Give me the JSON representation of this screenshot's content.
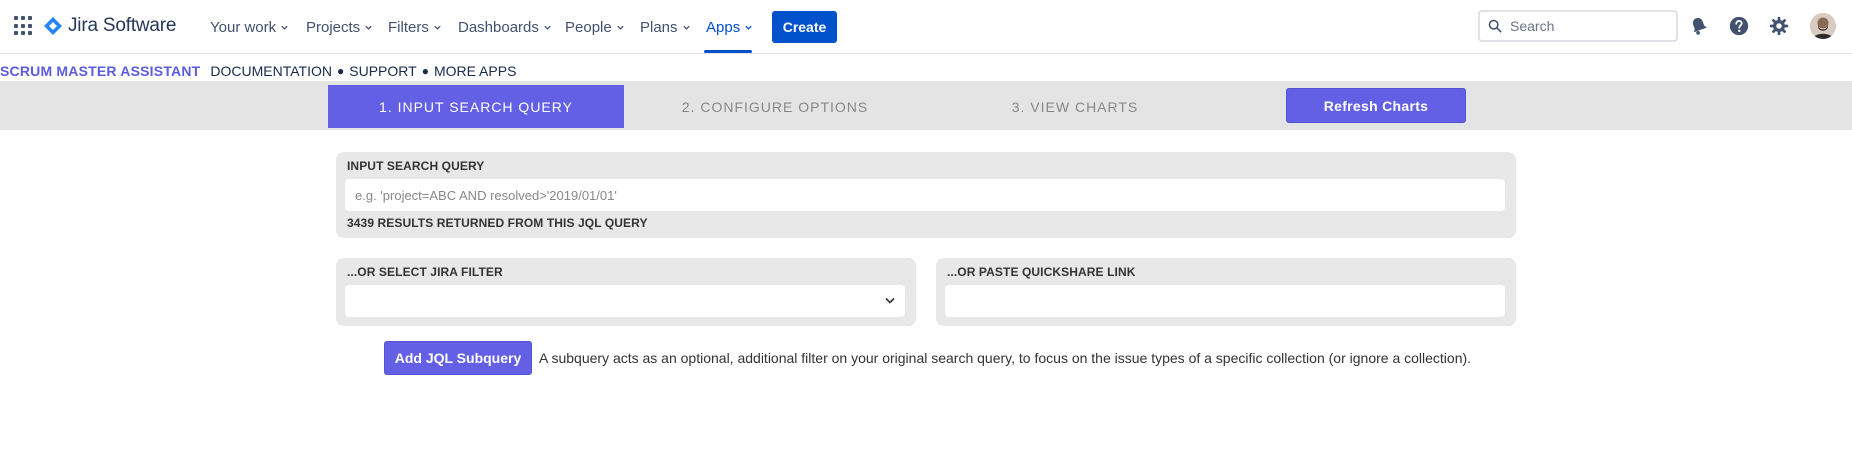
{
  "nav": {
    "brand": "Jira Software",
    "items": [
      {
        "label": "Your work",
        "active": false
      },
      {
        "label": "Projects",
        "active": false
      },
      {
        "label": "Filters",
        "active": false
      },
      {
        "label": "Dashboards",
        "active": false
      },
      {
        "label": "People",
        "active": false
      },
      {
        "label": "Plans",
        "active": false
      },
      {
        "label": "Apps",
        "active": true
      }
    ],
    "create_label": "Create",
    "search_placeholder": "Search",
    "icons": [
      "notifications-icon",
      "help-icon",
      "settings-icon"
    ],
    "accent_color": "#0052cc"
  },
  "plugin": {
    "name": "SCRUM MASTER ASSISTANT",
    "links": [
      "DOCUMENTATION",
      "SUPPORT",
      "MORE APPS"
    ],
    "separator": "●",
    "accent_color": "#6360e6"
  },
  "steps": {
    "items": [
      {
        "label": "1. INPUT SEARCH QUERY",
        "active": true
      },
      {
        "label": "2. CONFIGURE OPTIONS",
        "active": false
      },
      {
        "label": "3. VIEW CHARTS",
        "active": false
      }
    ],
    "refresh_label": "Refresh Charts"
  },
  "query": {
    "label": "INPUT SEARCH QUERY",
    "placeholder": "e.g. 'project=ABC AND resolved>'2019/01/01'",
    "value": "",
    "result_text": "3439 RESULTS RETURNED FROM THIS JQL QUERY"
  },
  "filter": {
    "label": "...OR SELECT JIRA FILTER",
    "selected": ""
  },
  "quickshare": {
    "label": "...OR PASTE QUICKSHARE LINK",
    "value": ""
  },
  "subquery": {
    "button_label": "Add JQL Subquery",
    "description": "A subquery acts as an optional, additional filter on your original search query, to focus on the issue types of a specific collection (or ignore a collection)."
  }
}
